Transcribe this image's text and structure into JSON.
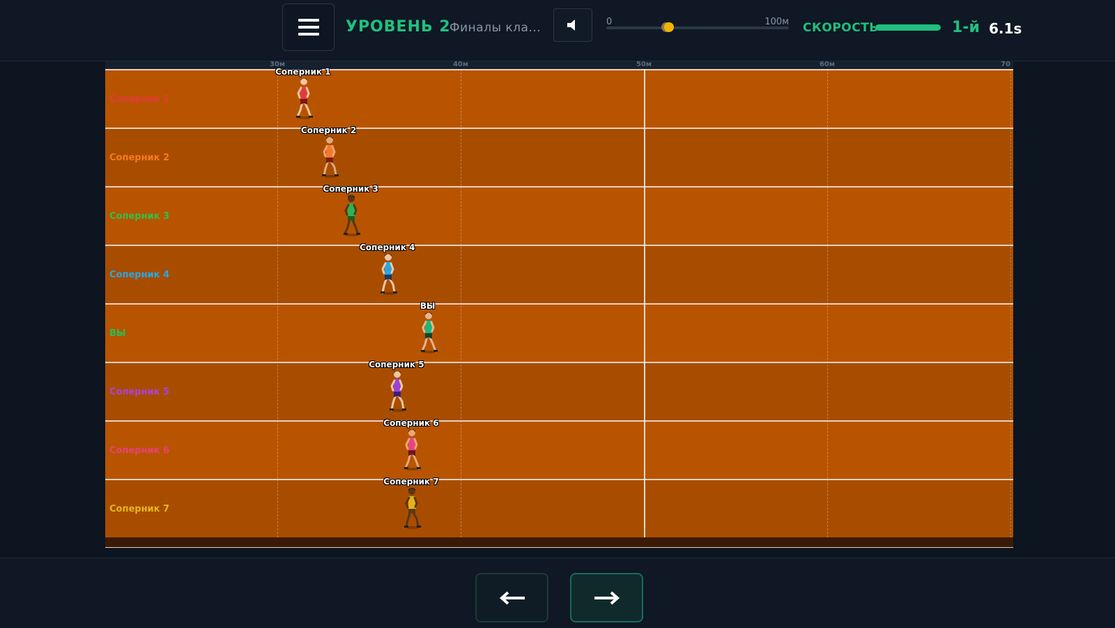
{
  "header": {
    "level_label": "УРОВЕНЬ 2",
    "subtitle": "Финалы кла...",
    "progress": {
      "start_label": "0",
      "end_label": "100м",
      "markers": [
        {
          "percent": 32.7,
          "color": "#e0443a"
        },
        {
          "percent": 33.6,
          "color": "#2fae5e"
        },
        {
          "percent": 34.5,
          "color": "#f4b400"
        }
      ]
    },
    "speed_label": "СКОРОСТЬ",
    "speed_level": 1.0,
    "place": "1-й",
    "time": "6.1s"
  },
  "track": {
    "distance_marks": [
      {
        "label": "30м"
      },
      {
        "label": "40м"
      },
      {
        "label": "50м"
      },
      {
        "label": "60м"
      },
      {
        "label": "70"
      }
    ],
    "lanes": [
      {
        "label": "Соперник 1",
        "color": "#e43a3a",
        "shirt": "#e23b3b",
        "shorts": "#7a1616",
        "skin": "#f1c6a1",
        "hair": "#5a2b10",
        "dist_m": 31.4
      },
      {
        "label": "Соперник 2",
        "color": "#f57a20",
        "shirt": "#f5792a",
        "shorts": "#7b1f14",
        "skin": "#e6a878",
        "hair": "#4b2a12",
        "dist_m": 32.8
      },
      {
        "label": "Соперник 3",
        "color": "#30c04a",
        "shirt": "#2fb44f",
        "shorts": "#1d5b26",
        "skin": "#5a3418",
        "hair": "#1a0d05",
        "dist_m": 34.0
      },
      {
        "label": "Соперник 4",
        "color": "#2aa7e6",
        "shirt": "#27a6e0",
        "shorts": "#1f3560",
        "skin": "#f1c6a1",
        "hair": "#3a1e0c",
        "dist_m": 36.0
      },
      {
        "label": "ВЫ",
        "color": "#23c257",
        "shirt": "#20b57a",
        "shorts": "#17402c",
        "skin": "#e8b58f",
        "hair": "#3a1e0c",
        "dist_m": 38.2
      },
      {
        "label": "Соперник 5",
        "color": "#b040d8",
        "shirt": "#9a42d6",
        "shorts": "#3b1f7a",
        "skin": "#f1c6a1",
        "hair": "#4b2a12",
        "dist_m": 36.5
      },
      {
        "label": "Соперник 6",
        "color": "#e8407a",
        "shirt": "#e8457d",
        "shorts": "#6b1620",
        "skin": "#e6a878",
        "hair": "#3a1e0c",
        "dist_m": 37.3
      },
      {
        "label": "Соперник 7",
        "color": "#e4b818",
        "shirt": "#e3b219",
        "shorts": "#5a3a12",
        "skin": "#5a3418",
        "hair": "#1a0d05",
        "dist_m": 37.3
      }
    ]
  },
  "controls": {
    "back_symbol": "←",
    "next_symbol": "→"
  }
}
